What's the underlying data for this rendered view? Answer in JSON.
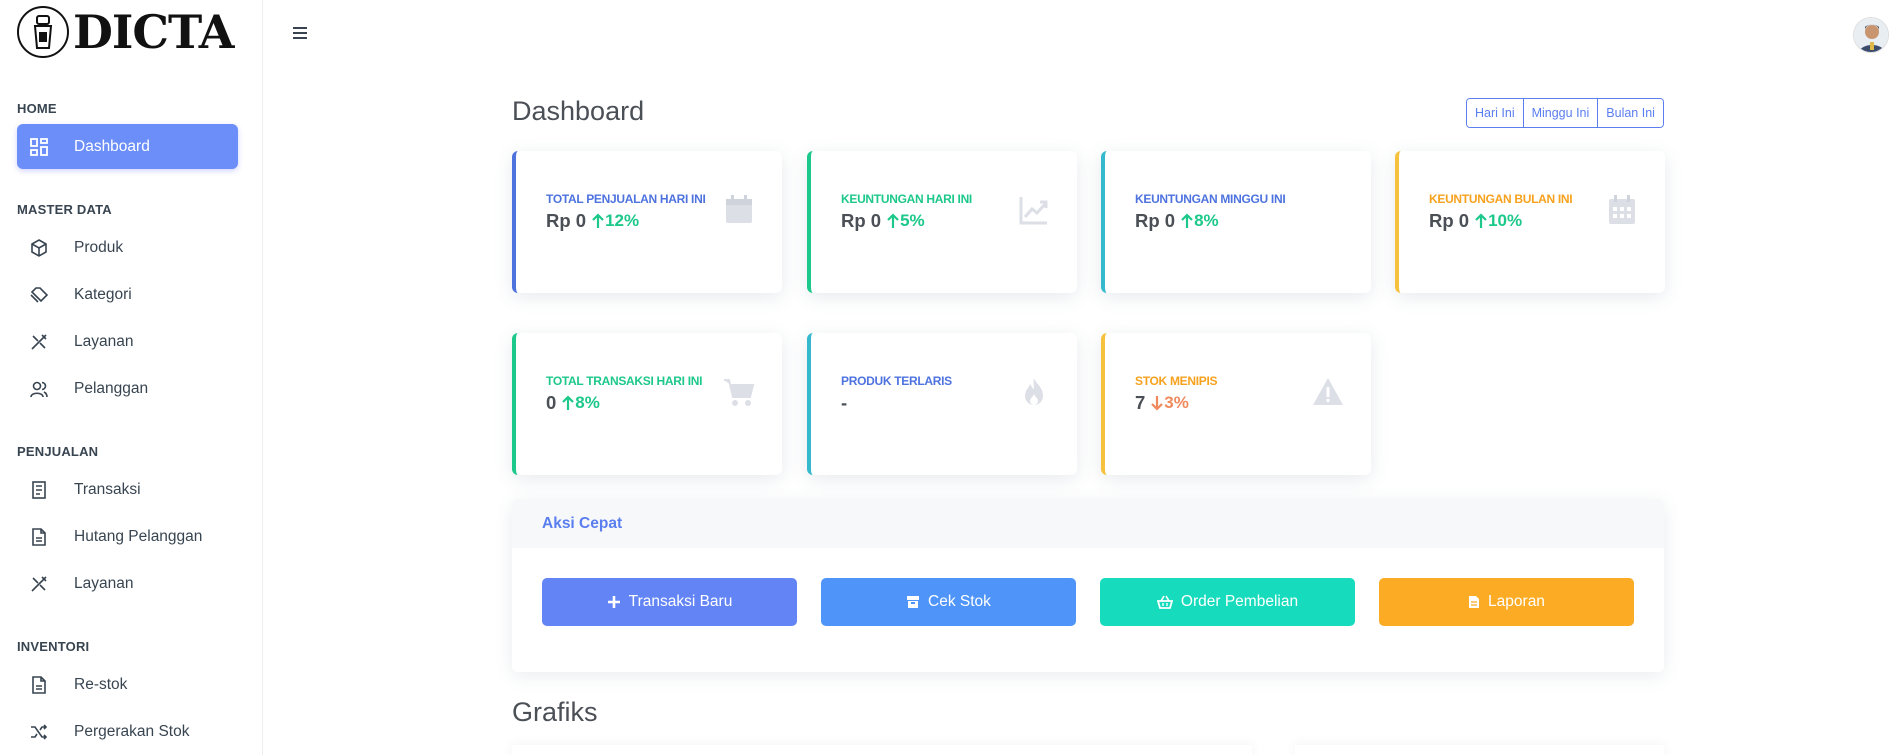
{
  "brand": {
    "logo_text": "DICTA"
  },
  "sidebar": {
    "sections": [
      {
        "header": "HOME",
        "items": [
          {
            "label": "Dashboard",
            "icon": "dashboard-icon",
            "active": true
          }
        ]
      },
      {
        "header": "MASTER DATA",
        "items": [
          {
            "label": "Produk",
            "icon": "cube-icon"
          },
          {
            "label": "Kategori",
            "icon": "tag-icon"
          },
          {
            "label": "Layanan",
            "icon": "tools-icon"
          },
          {
            "label": "Pelanggan",
            "icon": "users-icon"
          }
        ]
      },
      {
        "header": "PENJUALAN",
        "items": [
          {
            "label": "Transaksi",
            "icon": "receipt-icon"
          },
          {
            "label": "Hutang Pelanggan",
            "icon": "document-icon"
          },
          {
            "label": "Layanan",
            "icon": "tools-icon"
          }
        ]
      },
      {
        "header": "INVENTORI",
        "items": [
          {
            "label": "Re-stok",
            "icon": "document-icon"
          },
          {
            "label": "Pergerakan Stok",
            "icon": "shuffle-icon"
          }
        ]
      }
    ]
  },
  "main": {
    "title": "Dashboard",
    "period_filter": [
      "Hari Ini",
      "Minggu Ini",
      "Bulan Ini"
    ],
    "stats": [
      {
        "label": "TOTAL PENJUALAN HARI INI",
        "value": "Rp 0",
        "change": "12%",
        "direction": "up",
        "color": "#4e73df",
        "icon": "calendar-icon"
      },
      {
        "label": "KEUNTUNGAN HARI INI",
        "value": "Rp 0",
        "change": "5%",
        "direction": "up",
        "color": "#1cc88a",
        "icon": "chart-line-icon"
      },
      {
        "label": "KEUNTUNGAN MINGGU INI",
        "value": "Rp 0",
        "change": "8%",
        "direction": "up",
        "color": "#36b9cc",
        "icon": "none"
      },
      {
        "label": "KEUNTUNGAN BULAN INI",
        "value": "Rp 0",
        "change": "10%",
        "direction": "up",
        "color": "#f6c23e",
        "icon": "calendar-grid-icon"
      },
      {
        "label": "TOTAL TRANSAKSI HARI INI",
        "value": "0",
        "change": "8%",
        "direction": "up",
        "color": "#1cc88a",
        "icon": "cart-icon"
      },
      {
        "label": "PRODUK TERLARIS",
        "value": "-",
        "change": "",
        "direction": "none",
        "color": "#36b9cc",
        "icon": "fire-icon"
      },
      {
        "label": "STOK MENIPIS",
        "value": "7",
        "change": "3%",
        "direction": "down",
        "color": "#f6c23e",
        "icon": "warning-icon"
      }
    ],
    "quick_actions": {
      "title": "Aksi Cepat",
      "buttons": [
        {
          "label": "Transaksi Baru",
          "icon": "plus-icon",
          "color": "#6384f5"
        },
        {
          "label": "Cek Stok",
          "icon": "box-icon",
          "color": "#4f95f9"
        },
        {
          "label": "Order Pembelian",
          "icon": "basket-icon",
          "color": "#16dbbc"
        },
        {
          "label": "Laporan",
          "icon": "file-icon",
          "color": "#fbab24"
        }
      ]
    },
    "charts_title": "Grafiks"
  },
  "colors": {
    "up": "#1cc88a",
    "down": "#f08a5d",
    "accent": "#6b8ef9"
  }
}
